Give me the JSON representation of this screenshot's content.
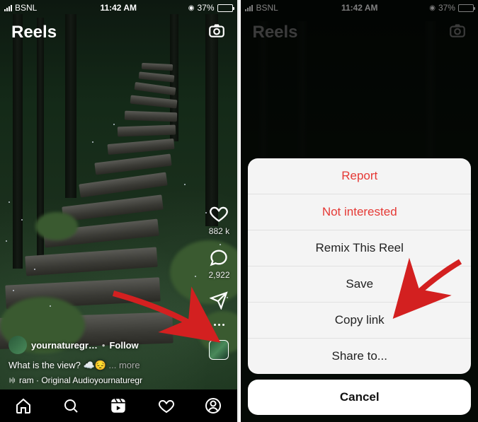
{
  "status": {
    "carrier": "BSNL",
    "time": "11:42 AM",
    "battery": "37%"
  },
  "header": {
    "title": "Reels"
  },
  "post": {
    "username": "yournaturegr…",
    "follow_label": "Follow",
    "caption_text": "What is the view?",
    "more_label": "more",
    "audio_text": "ram · Original Audioyournaturegr"
  },
  "counts": {
    "likes": "882 k",
    "comments": "2,922"
  },
  "sheet": {
    "report": "Report",
    "not_interested": "Not interested",
    "remix": "Remix This Reel",
    "save": "Save",
    "copy_link": "Copy link",
    "share_to": "Share to...",
    "cancel": "Cancel"
  },
  "icons": {
    "camera": "camera-icon",
    "heart": "heart-icon",
    "comment": "comment-icon",
    "share": "share-icon",
    "more": "more-icon",
    "home": "home-icon",
    "search": "search-icon",
    "reels": "reels-icon",
    "activity": "activity-icon",
    "profile": "profile-icon",
    "music": "music-icon"
  }
}
